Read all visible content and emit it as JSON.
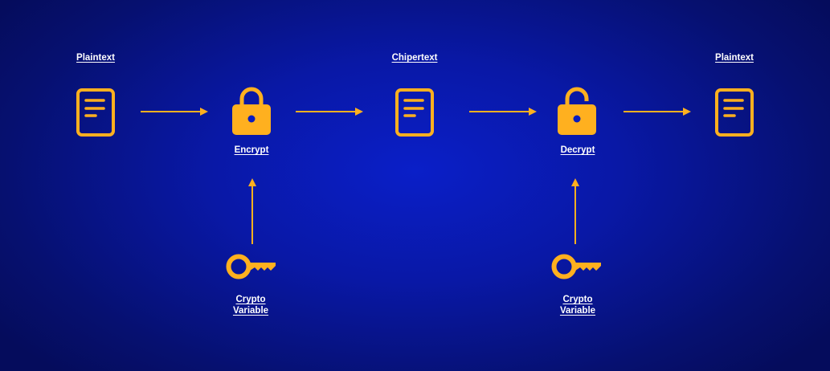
{
  "diagram": {
    "title_left": "Plaintext",
    "title_middle": "Chipertext",
    "title_right": "Plaintext",
    "encrypt_label": "Encrypt",
    "decrypt_label": "Decrypt",
    "key_left_label": [
      "Crypto",
      "Variable"
    ],
    "key_right_label": [
      "Crypto",
      "Variable"
    ]
  },
  "colors": {
    "accent": "#ffb01f",
    "text": "#ffffff",
    "background": "#0a1cbf"
  }
}
